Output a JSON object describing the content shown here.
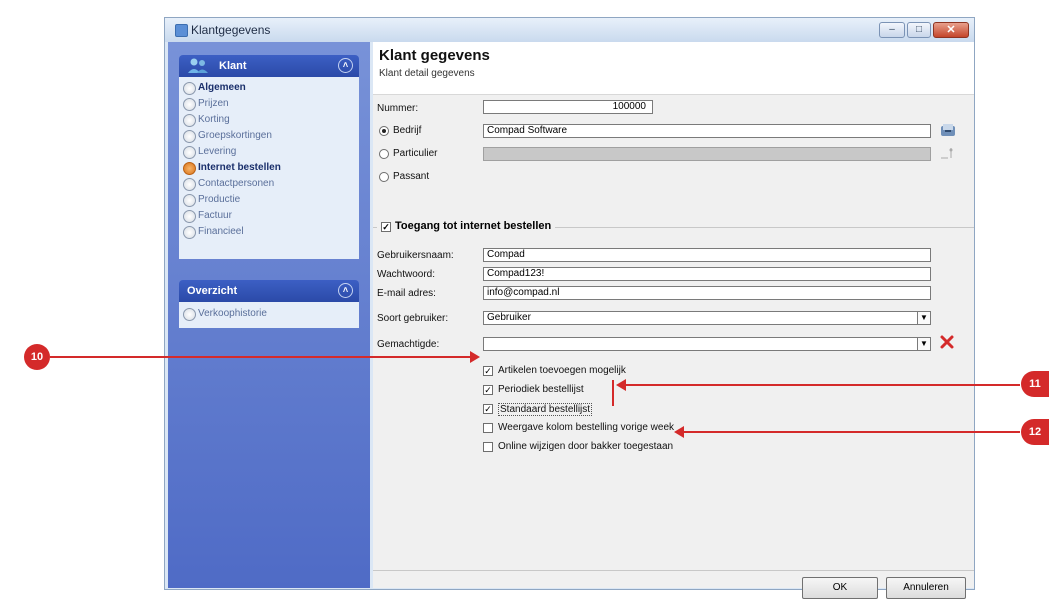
{
  "window": {
    "title": "Klantgegevens"
  },
  "sidebar": {
    "panel1": {
      "title": "Klant",
      "items": [
        {
          "label": "Algemeen",
          "bold": true,
          "active": false
        },
        {
          "label": "Prijzen",
          "bold": false,
          "active": false
        },
        {
          "label": "Korting",
          "bold": false,
          "active": false
        },
        {
          "label": "Groepskortingen",
          "bold": false,
          "active": false
        },
        {
          "label": "Levering",
          "bold": false,
          "active": false
        },
        {
          "label": "Internet bestellen",
          "bold": true,
          "active": true
        },
        {
          "label": "Contactpersonen",
          "bold": false,
          "active": false
        },
        {
          "label": "Productie",
          "bold": false,
          "active": false
        },
        {
          "label": "Factuur",
          "bold": false,
          "active": false
        },
        {
          "label": "Financieel",
          "bold": false,
          "active": false
        }
      ]
    },
    "panel2": {
      "title": "Overzicht",
      "items": [
        {
          "label": "Verkoophistorie"
        }
      ]
    }
  },
  "header": {
    "title": "Klant gegevens",
    "subtitle": "Klant detail gegevens"
  },
  "form": {
    "nummer_label": "Nummer:",
    "nummer_value": "100000",
    "bedrijf_label": "Bedrijf",
    "bedrijf_value": "Compad Software",
    "particulier_label": "Particulier",
    "passant_label": "Passant",
    "group_title": "Toegang tot internet bestellen",
    "gebruikersnaam_label": "Gebruikersnaam:",
    "gebruikersnaam_value": "Compad",
    "wachtwoord_label": "Wachtwoord:",
    "wachtwoord_value": "Compad123!",
    "email_label": "E-mail adres:",
    "email_value": "info@compad.nl",
    "soort_label": "Soort gebruiker:",
    "soort_value": "Gebruiker",
    "gemachtigde_label": "Gemachtigde:",
    "gemachtigde_value": "",
    "options": [
      {
        "label": "Artikelen toevoegen mogelijk",
        "checked": true
      },
      {
        "label": "Periodiek bestellijst",
        "checked": true
      },
      {
        "label": "Standaard bestellijst",
        "checked": true
      },
      {
        "label": "Weergave kolom bestelling vorige week",
        "checked": false
      },
      {
        "label": "Online wijzigen door bakker toegestaan",
        "checked": false
      }
    ]
  },
  "buttons": {
    "ok": "OK",
    "cancel": "Annuleren"
  },
  "annotations": {
    "a10": "10",
    "a11": "11",
    "a12": "12"
  },
  "colors": {
    "annotation": "#d42a2a",
    "sidebar": "#5b76cc",
    "active_radio": "#e8891f"
  }
}
